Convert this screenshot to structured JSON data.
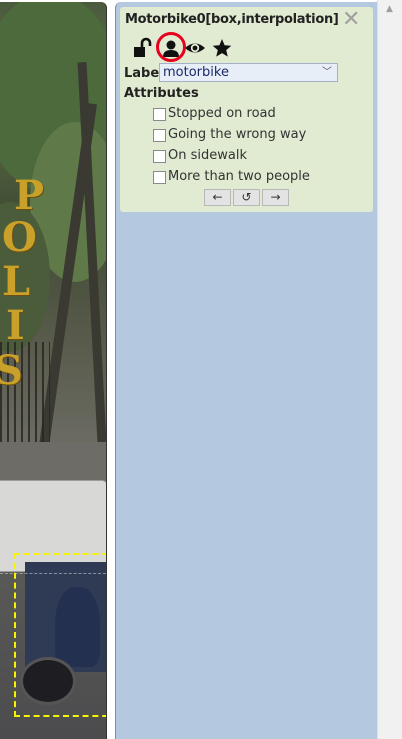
{
  "object_panel": {
    "title": "Motorbike0[box,interpolation]",
    "close_symbol": "✕",
    "icons": [
      {
        "name": "unlock-icon"
      },
      {
        "name": "user-icon",
        "highlighted": true
      },
      {
        "name": "eye-icon"
      },
      {
        "name": "star-icon"
      }
    ],
    "label_caption": "Label",
    "label_value": "motorbike",
    "attributes_heading": "Attributes",
    "attributes": [
      {
        "label": "Stopped on road",
        "checked": false
      },
      {
        "label": "Going the wrong way",
        "checked": false
      },
      {
        "label": "On sidewalk",
        "checked": false
      },
      {
        "label": "More than two people",
        "checked": false
      }
    ],
    "nav": {
      "prev": "←",
      "reset": "↺",
      "next": "→"
    }
  },
  "video": {
    "sign_letters": [
      "P",
      "O",
      "L",
      "I",
      "S"
    ],
    "bbox_color": "#f7f500"
  },
  "colors": {
    "sidebar_bg": "#b4c8df",
    "panel_bg": "#e0ebd2",
    "highlight": "#e8001c"
  }
}
